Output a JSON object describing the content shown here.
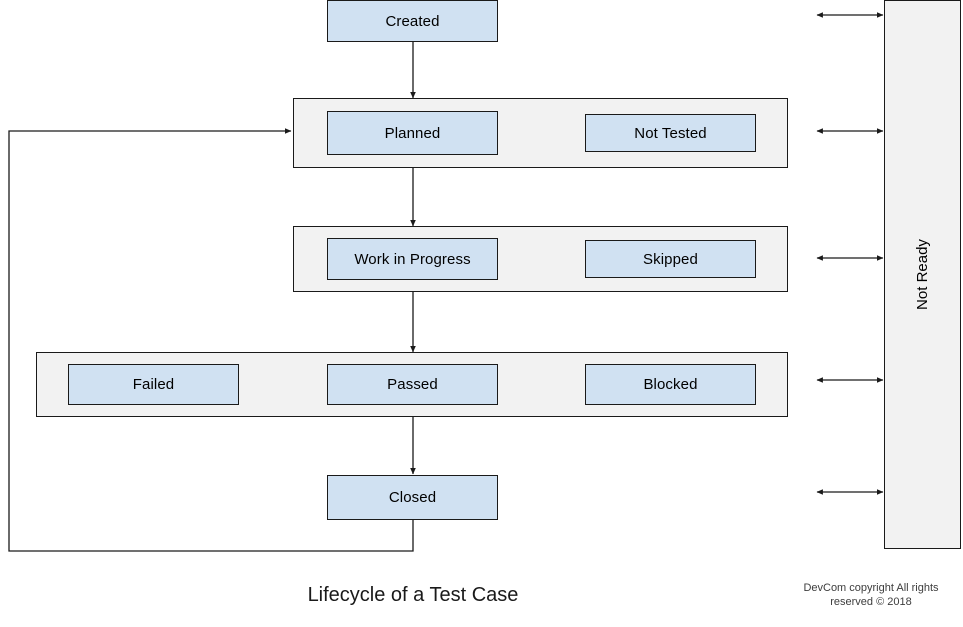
{
  "diagram": {
    "title": "Lifecycle of a Test Case",
    "copyright_line_1": "DevCom copyright All rights",
    "copyright_line_2": "reserved © 2018",
    "colors": {
      "state_fill": "#d0e1f2",
      "group_fill": "#f2f2f2",
      "stroke": "#1a1a1a",
      "page_background": "#ffffff"
    },
    "side_panel": {
      "label": "Not Ready",
      "orientation": "vertical"
    },
    "states": [
      {
        "id": "created",
        "label": "Created"
      },
      {
        "id": "planned",
        "label": "Planned"
      },
      {
        "id": "not-tested",
        "label": "Not Tested"
      },
      {
        "id": "work-in-progress",
        "label": "Work in Progress"
      },
      {
        "id": "skipped",
        "label": "Skipped"
      },
      {
        "id": "failed",
        "label": "Failed"
      },
      {
        "id": "passed",
        "label": "Passed"
      },
      {
        "id": "blocked",
        "label": "Blocked"
      },
      {
        "id": "closed",
        "label": "Closed"
      }
    ],
    "groups": [
      {
        "id": "planned-group",
        "members": [
          "Planned",
          "Not Tested"
        ]
      },
      {
        "id": "in-progress-group",
        "members": [
          "Work in Progress",
          "Skipped"
        ]
      },
      {
        "id": "result-group",
        "members": [
          "Failed",
          "Passed",
          "Blocked"
        ]
      }
    ],
    "connections": [
      {
        "from": "Created",
        "to": "Planned",
        "type": "arrow-down"
      },
      {
        "from": "Planned",
        "to": "Work in Progress",
        "type": "arrow-down"
      },
      {
        "from": "Work in Progress",
        "to": "Passed",
        "type": "arrow-down"
      },
      {
        "from": "Passed",
        "to": "Closed",
        "type": "arrow-down"
      },
      {
        "from": "Closed",
        "to": "Planned",
        "type": "loop-back-left"
      },
      {
        "from": "Created",
        "to": "Not Ready",
        "type": "bidirectional"
      },
      {
        "from": "Planned",
        "to": "Not Ready",
        "type": "bidirectional"
      },
      {
        "from": "Work in Progress",
        "to": "Not Ready",
        "type": "bidirectional"
      },
      {
        "from": "Passed",
        "to": "Not Ready",
        "type": "bidirectional"
      },
      {
        "from": "Closed",
        "to": "Not Ready",
        "type": "bidirectional"
      }
    ]
  }
}
